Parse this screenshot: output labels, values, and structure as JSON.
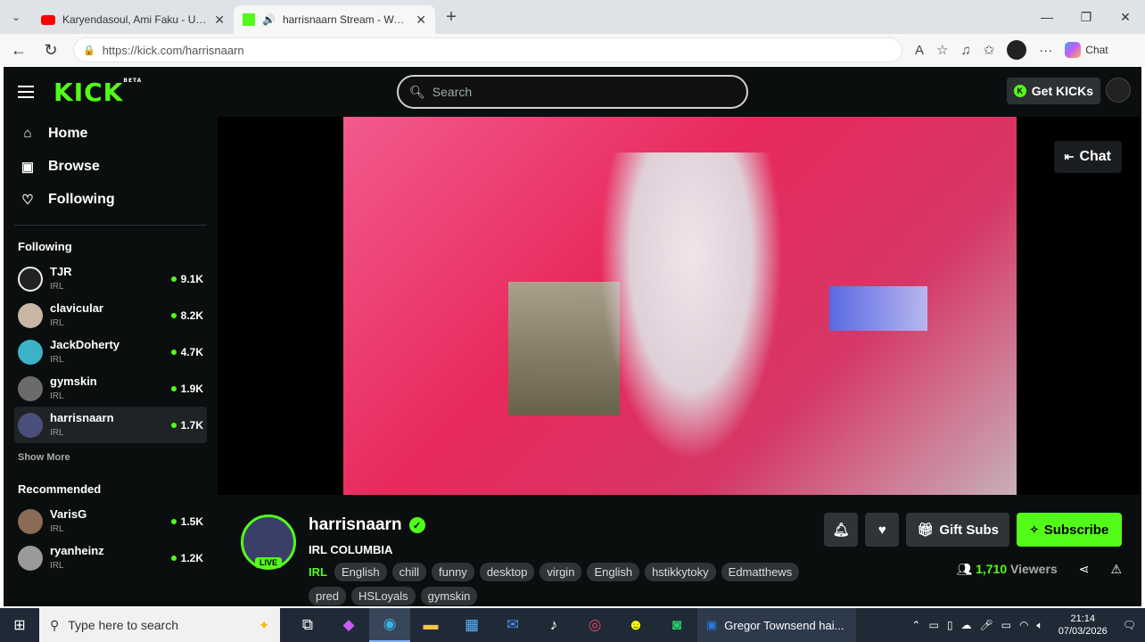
{
  "browser": {
    "tabs": [
      {
        "title": "Karyendasoul, Ami Faku - Umthan",
        "active": false
      },
      {
        "title": "harrisnaarn Stream - Watch Li",
        "active": true
      }
    ],
    "url": "https://kick.com/harrisnaarn",
    "chat_label": "Chat"
  },
  "header": {
    "logo": "KICK",
    "logo_badge": "BETA",
    "search_placeholder": "Search",
    "get_kicks": "Get KICKs"
  },
  "sidebar": {
    "nav": [
      {
        "label": "Home",
        "icon": "home-icon"
      },
      {
        "label": "Browse",
        "icon": "browse-icon"
      },
      {
        "label": "Following",
        "icon": "heart-icon"
      }
    ],
    "following_title": "Following",
    "following": [
      {
        "name": "TJR",
        "category": "IRL",
        "viewers": "9.1K"
      },
      {
        "name": "clavicular",
        "category": "IRL",
        "viewers": "8.2K"
      },
      {
        "name": "JackDoherty",
        "category": "IRL",
        "viewers": "4.7K"
      },
      {
        "name": "gymskin",
        "category": "IRL",
        "viewers": "1.9K"
      },
      {
        "name": "harrisnaarn",
        "category": "IRL",
        "viewers": "1.7K"
      }
    ],
    "show_more": "Show More",
    "recommended_title": "Recommended",
    "recommended": [
      {
        "name": "VarisG",
        "category": "IRL",
        "viewers": "1.5K"
      },
      {
        "name": "ryanheinz",
        "category": "IRL",
        "viewers": "1.2K"
      }
    ]
  },
  "player": {
    "chat_button": "Chat"
  },
  "stream": {
    "channel": "harrisnaarn",
    "live_badge": "LIVE",
    "title": "IRL COLUMBIA",
    "category": "IRL",
    "tags": [
      "English",
      "chill",
      "funny",
      "desktop",
      "virgin",
      "English",
      "hstikkytoky",
      "Edmatthews",
      "pred",
      "HSLoyals",
      "gymskin"
    ],
    "gift_subs": "Gift Subs",
    "subscribe": "Subscribe",
    "viewer_count": "1,710",
    "viewer_label": "Viewers"
  },
  "taskbar": {
    "search_placeholder": "Type here to search",
    "window_title": "Gregor Townsend hai...",
    "time": "21:14",
    "date": "07/03/2026"
  }
}
